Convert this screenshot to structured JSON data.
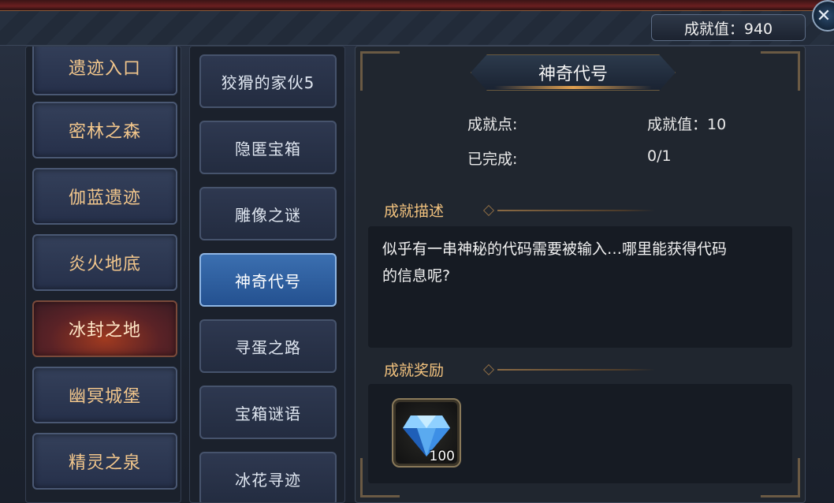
{
  "header": {
    "score_label": "成就值：940",
    "close_label": "✕"
  },
  "zones": [
    {
      "label": "遗迹入口",
      "active": false
    },
    {
      "label": "密林之森",
      "active": false
    },
    {
      "label": "伽蓝遗迹",
      "active": false
    },
    {
      "label": "炎火地底",
      "active": false
    },
    {
      "label": "冰封之地",
      "active": true
    },
    {
      "label": "幽冥城堡",
      "active": false
    },
    {
      "label": "精灵之泉",
      "active": false
    }
  ],
  "achievements": [
    {
      "label": "狡猾的家伙5",
      "active": false
    },
    {
      "label": "隐匿宝箱",
      "active": false
    },
    {
      "label": "雕像之谜",
      "active": false
    },
    {
      "label": "神奇代号",
      "active": true
    },
    {
      "label": "寻蛋之路",
      "active": false
    },
    {
      "label": "宝箱谜语",
      "active": false
    },
    {
      "label": "冰花寻迹",
      "active": false
    }
  ],
  "detail": {
    "title": "神奇代号",
    "points_label": "成就点:",
    "points_value": "成就值：10",
    "completed_label": "已完成:",
    "completed_value": "0/1",
    "desc_heading": "成就描述",
    "desc_text_line1": "似乎有一串神秘的代码需要被输入…哪里能获得代码",
    "desc_text_line2": "的信息呢?",
    "reward_heading": "成就奖励",
    "reward": {
      "icon": "diamond-icon",
      "count": "100"
    }
  },
  "colors": {
    "zone_text": "#f3c78c",
    "active_zone": "#a03a20",
    "active_achievement": "#3b6fb0",
    "section_heading": "#f2c27e"
  }
}
